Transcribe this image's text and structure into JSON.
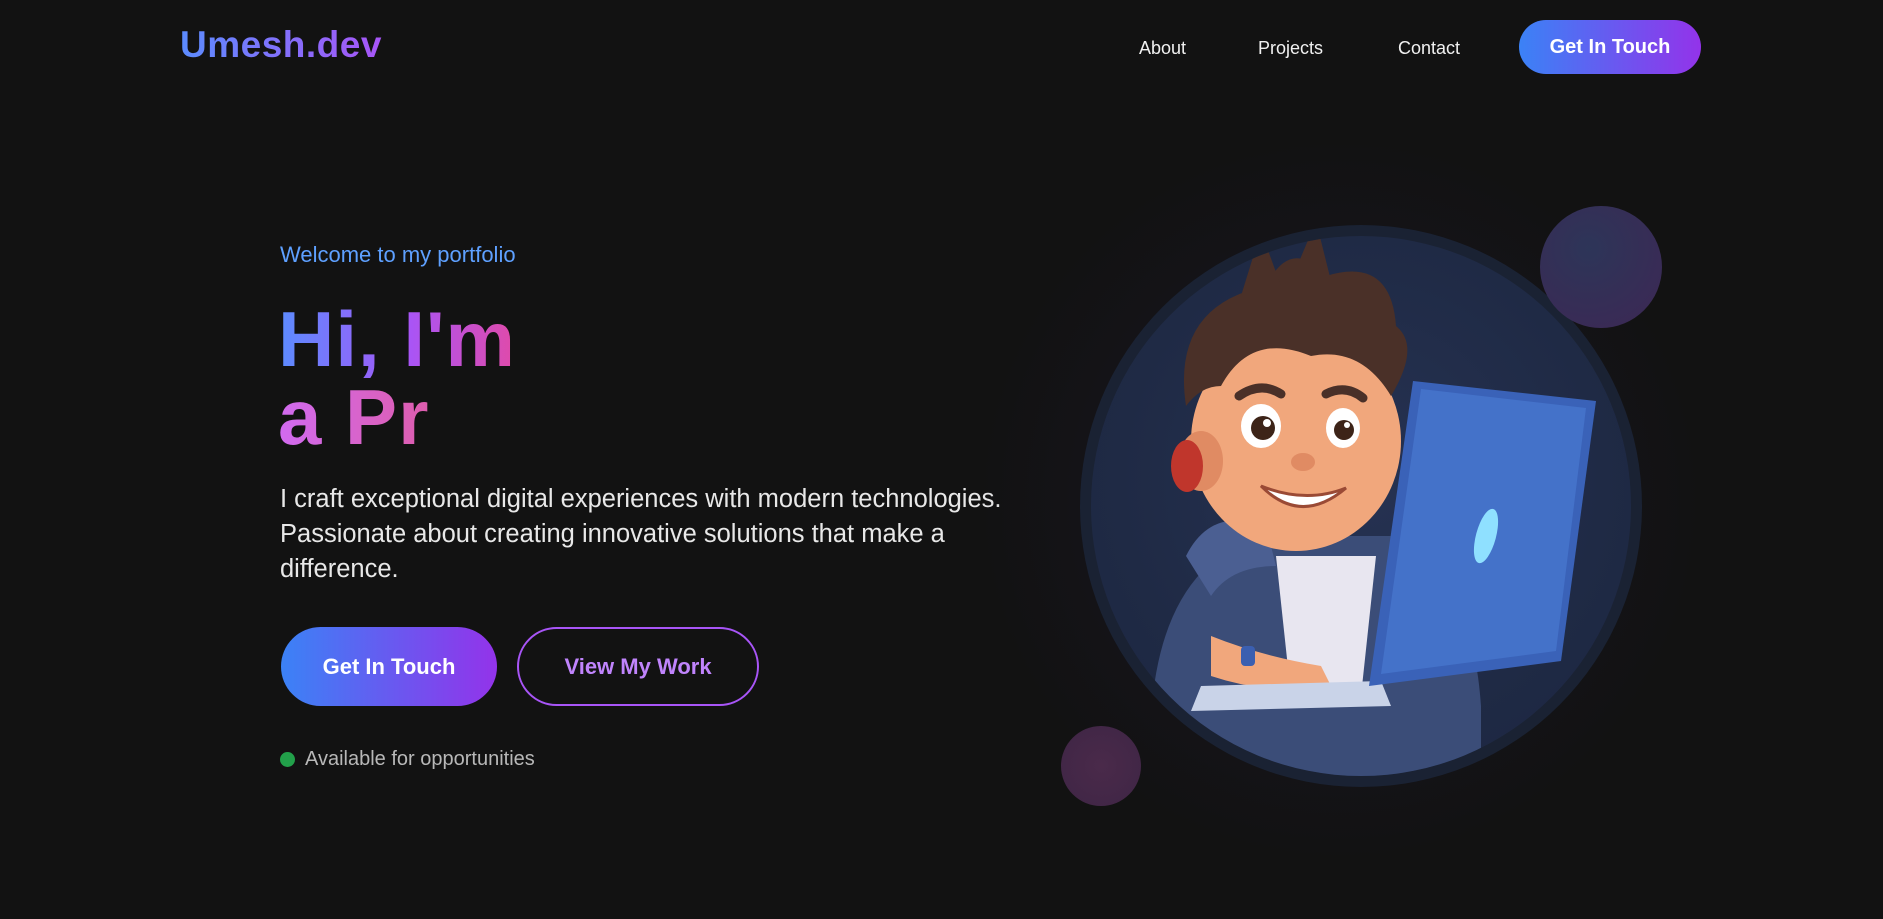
{
  "nav": {
    "logo": "Umesh.dev",
    "links": [
      {
        "label": "About"
      },
      {
        "label": "Projects"
      },
      {
        "label": "Contact"
      }
    ],
    "cta_label": "Get In Touch"
  },
  "hero": {
    "eyebrow": "Welcome to my portfolio",
    "headline_line1": "Hi, I'm",
    "headline_line2": "a Pr",
    "description": "I craft exceptional digital experiences with modern technologies. Passionate about creating innovative solutions that make a difference.",
    "primary_button": "Get In Touch",
    "secondary_button": "View My Work",
    "status": "Available for opportunities"
  },
  "colors": {
    "background": "#121212",
    "accent_blue": "#3b82f6",
    "accent_purple": "#9333ea",
    "status_green": "#22a04a"
  },
  "icons": {
    "status": "status-dot-icon",
    "avatar": "developer-avatar-illustration"
  }
}
